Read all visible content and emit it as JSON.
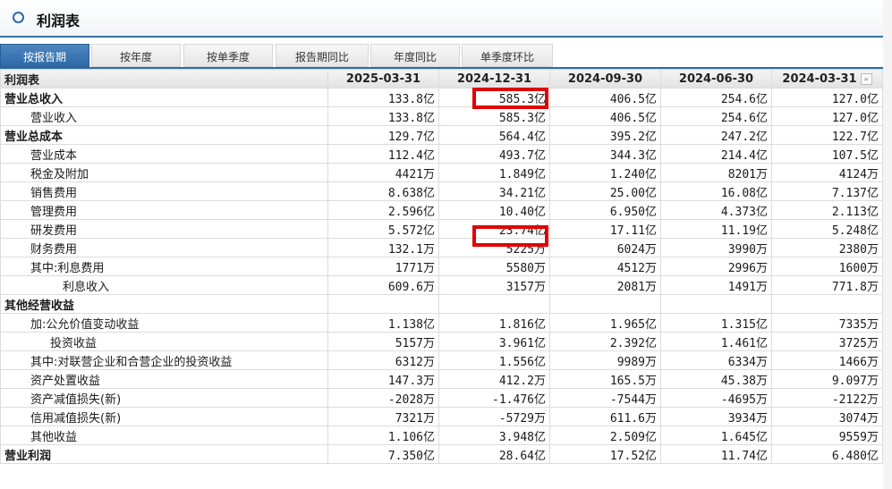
{
  "header": {
    "title": "利润表"
  },
  "tabs": [
    "按报告期",
    "按年度",
    "按单季度",
    "报告期同比",
    "年度同比",
    "单季度环比"
  ],
  "table": {
    "name_header": "利润表",
    "columns": [
      "2025-03-31",
      "2024-12-31",
      "2024-09-30",
      "2024-06-30",
      "2024-03-31"
    ],
    "more_icon": "»",
    "rows": [
      {
        "name": "营业总收入",
        "level": 0,
        "bold": true,
        "values": [
          "133.8亿",
          "585.3亿",
          "406.5亿",
          "254.6亿",
          "127.0亿"
        ]
      },
      {
        "name": "营业收入",
        "level": 1,
        "bold": false,
        "values": [
          "133.8亿",
          "585.3亿",
          "406.5亿",
          "254.6亿",
          "127.0亿"
        ]
      },
      {
        "name": "营业总成本",
        "level": 0,
        "bold": true,
        "values": [
          "129.7亿",
          "564.4亿",
          "395.2亿",
          "247.2亿",
          "122.7亿"
        ]
      },
      {
        "name": "营业成本",
        "level": 1,
        "bold": false,
        "values": [
          "112.4亿",
          "493.7亿",
          "344.3亿",
          "214.4亿",
          "107.5亿"
        ]
      },
      {
        "name": "税金及附加",
        "level": 1,
        "bold": false,
        "values": [
          "4421万",
          "1.849亿",
          "1.240亿",
          "8201万",
          "4124万"
        ]
      },
      {
        "name": "销售费用",
        "level": 1,
        "bold": false,
        "values": [
          "8.638亿",
          "34.21亿",
          "25.00亿",
          "16.08亿",
          "7.137亿"
        ]
      },
      {
        "name": "管理费用",
        "level": 1,
        "bold": false,
        "values": [
          "2.596亿",
          "10.40亿",
          "6.950亿",
          "4.373亿",
          "2.113亿"
        ]
      },
      {
        "name": "研发费用",
        "level": 1,
        "bold": false,
        "values": [
          "5.572亿",
          "23.74亿",
          "17.11亿",
          "11.19亿",
          "5.248亿"
        ]
      },
      {
        "name": "财务费用",
        "level": 1,
        "bold": false,
        "values": [
          "132.1万",
          "5225万",
          "6024万",
          "3990万",
          "2380万"
        ]
      },
      {
        "name": "其中:利息费用",
        "level": 1,
        "bold": false,
        "values": [
          "1771万",
          "5580万",
          "4512万",
          "2996万",
          "1600万"
        ]
      },
      {
        "name": "利息收入",
        "level": 3,
        "bold": false,
        "values": [
          "609.6万",
          "3157万",
          "2081万",
          "1491万",
          "771.8万"
        ]
      },
      {
        "name": "其他经营收益",
        "level": 0,
        "bold": true,
        "values": [
          "",
          "",
          "",
          "",
          ""
        ]
      },
      {
        "name": "加:公允价值变动收益",
        "level": 1,
        "bold": false,
        "values": [
          "1.138亿",
          "1.816亿",
          "1.965亿",
          "1.315亿",
          "7335万"
        ]
      },
      {
        "name": "投资收益",
        "level": 2,
        "bold": false,
        "values": [
          "5157万",
          "3.961亿",
          "2.392亿",
          "1.461亿",
          "3725万"
        ]
      },
      {
        "name": "其中:对联营企业和合营企业的投资收益",
        "level": 1,
        "bold": false,
        "values": [
          "6312万",
          "1.556亿",
          "9989万",
          "6334万",
          "1466万"
        ]
      },
      {
        "name": "资产处置收益",
        "level": 1,
        "bold": false,
        "values": [
          "147.3万",
          "412.2万",
          "165.5万",
          "45.38万",
          "9.097万"
        ]
      },
      {
        "name": "资产减值损失(新)",
        "level": 1,
        "bold": false,
        "values": [
          "-2028万",
          "-1.476亿",
          "-7544万",
          "-4695万",
          "-2122万"
        ]
      },
      {
        "name": "信用减值损失(新)",
        "level": 1,
        "bold": false,
        "values": [
          "7321万",
          "-5729万",
          "611.6万",
          "3934万",
          "3074万"
        ]
      },
      {
        "name": "其他收益",
        "level": 1,
        "bold": false,
        "values": [
          "1.106亿",
          "3.948亿",
          "2.509亿",
          "1.645亿",
          "9559万"
        ]
      },
      {
        "name": "营业利润",
        "level": 0,
        "bold": true,
        "values": [
          "7.350亿",
          "28.64亿",
          "17.52亿",
          "11.74亿",
          "6.480亿"
        ]
      }
    ]
  },
  "highlight_color": "#e00000"
}
